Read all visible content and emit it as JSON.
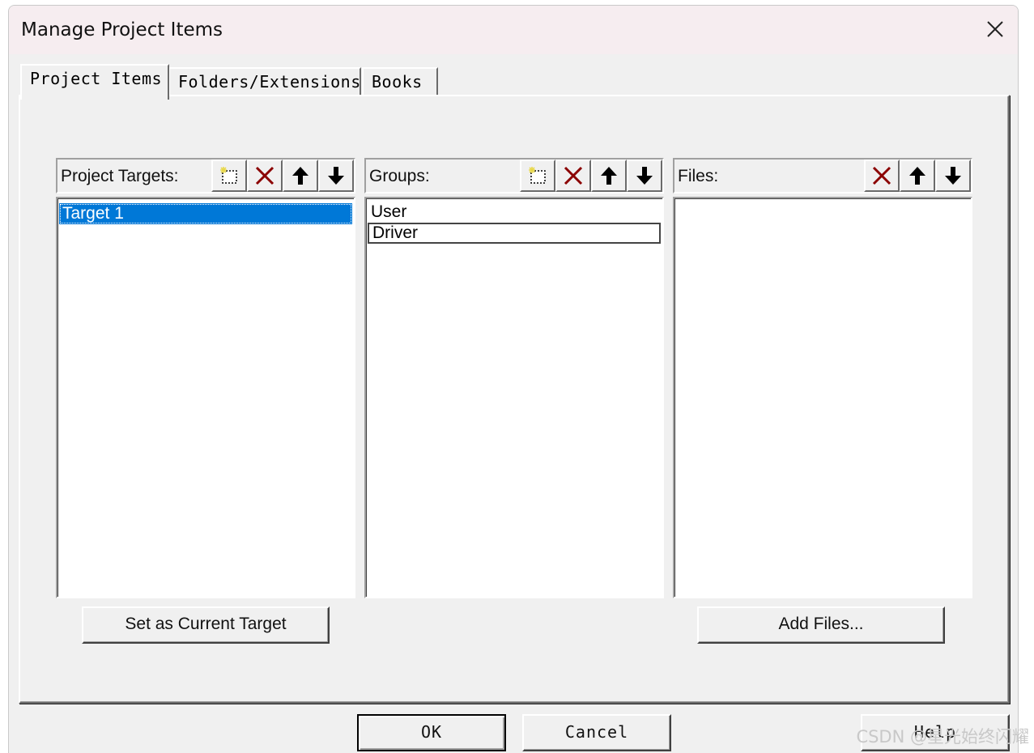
{
  "window": {
    "title": "Manage Project Items"
  },
  "tabs": [
    {
      "label": "Project Items",
      "active": true
    },
    {
      "label": "Folders/Extensions",
      "active": false
    },
    {
      "label": "Books",
      "active": false
    }
  ],
  "targets_panel": {
    "label": "Project Targets:",
    "items": [
      "Target 1"
    ],
    "selected": "Target 1",
    "tool_icons": [
      "new-item-icon",
      "delete-icon",
      "move-up-icon",
      "move-down-icon"
    ]
  },
  "groups_panel": {
    "label": "Groups:",
    "items": [
      "User",
      "Driver"
    ],
    "focused": "Driver",
    "tool_icons": [
      "new-item-icon",
      "delete-icon",
      "move-up-icon",
      "move-down-icon"
    ]
  },
  "files_panel": {
    "label": "Files:",
    "items": [],
    "tool_icons": [
      "delete-icon",
      "move-up-icon",
      "move-down-icon"
    ]
  },
  "buttons": {
    "set_current_target": "Set as Current Target",
    "add_files": "Add Files...",
    "ok": "OK",
    "cancel": "Cancel",
    "help": "Help"
  },
  "watermark": "CSDN @星光始终闪耀",
  "colors": {
    "selection": "#0078d7",
    "delete_icon": "#8b0000",
    "new_icon_accent": "#e8d84a"
  }
}
